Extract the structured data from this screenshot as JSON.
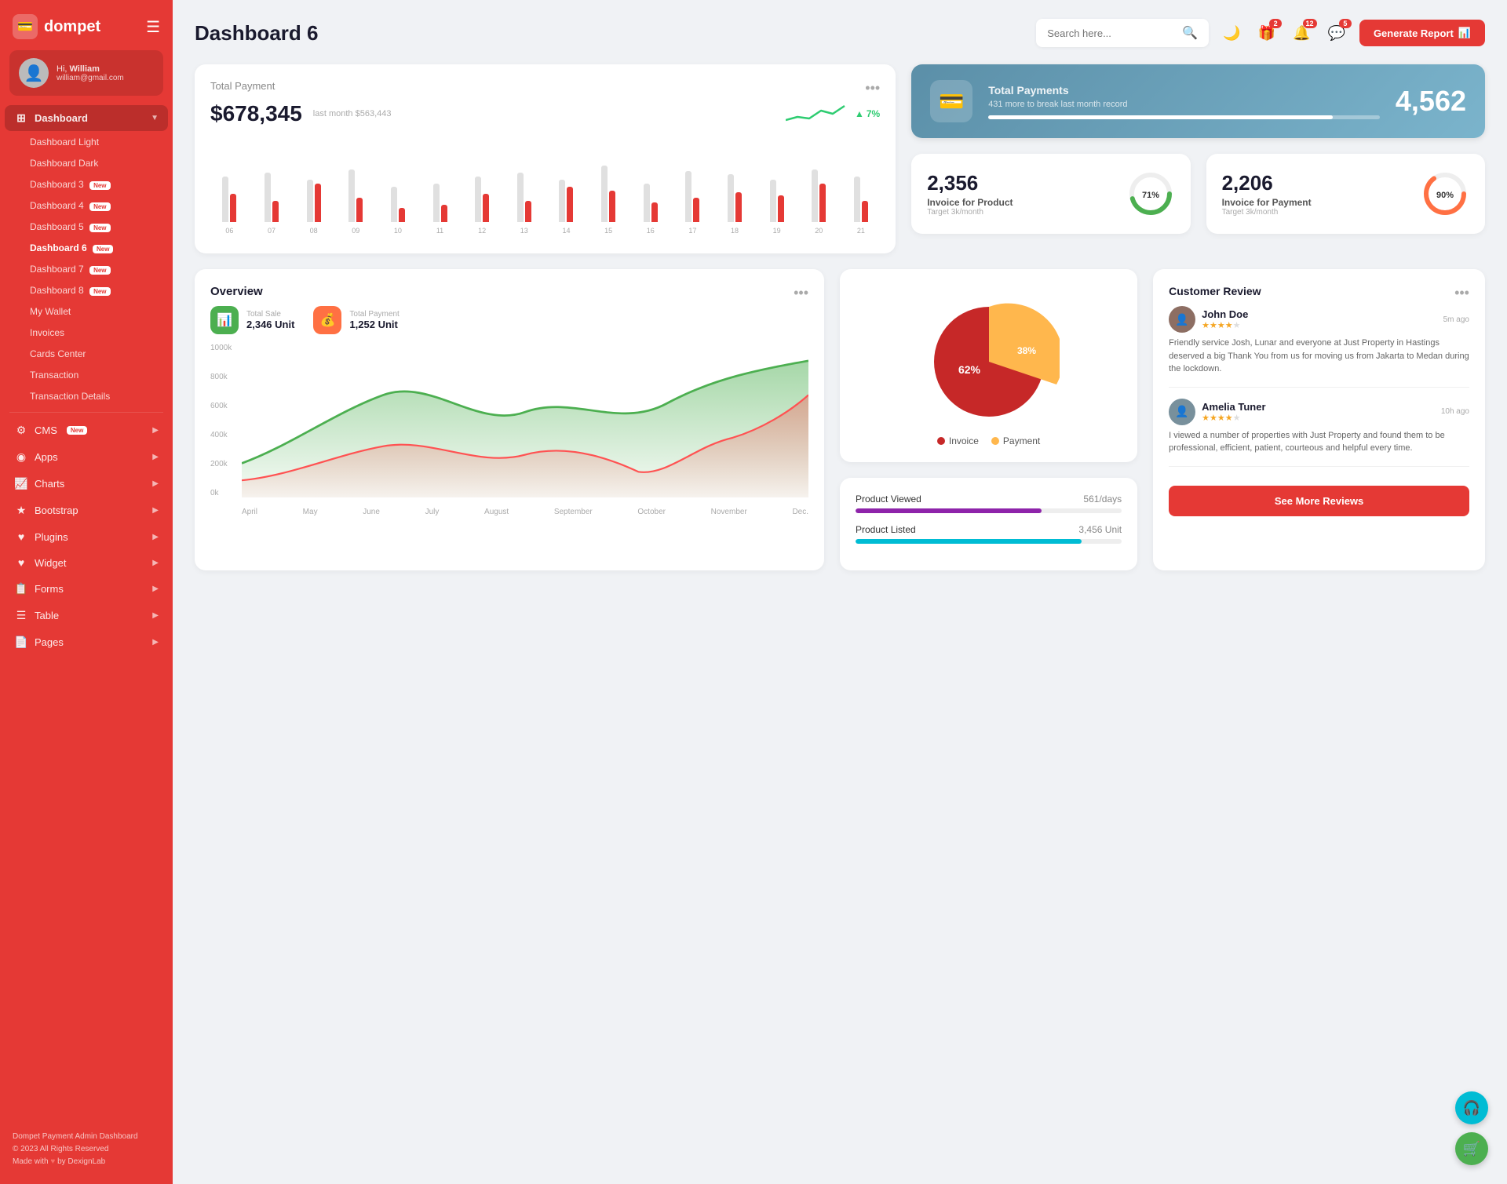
{
  "app": {
    "name": "dompet",
    "logo_icon": "💳"
  },
  "user": {
    "greeting": "Hi, William",
    "name": "William",
    "email": "william@gmail.com",
    "avatar_icon": "👤"
  },
  "sidebar": {
    "nav": [
      {
        "id": "dashboard",
        "label": "Dashboard",
        "icon": "⊞",
        "has_arrow": true,
        "active": true
      },
      {
        "id": "cms",
        "label": "CMS",
        "icon": "⚙",
        "has_arrow": true,
        "badge": "New"
      },
      {
        "id": "apps",
        "label": "Apps",
        "icon": "◉",
        "has_arrow": true
      },
      {
        "id": "charts",
        "label": "Charts",
        "icon": "📈",
        "has_arrow": true
      },
      {
        "id": "bootstrap",
        "label": "Bootstrap",
        "icon": "★",
        "has_arrow": true
      },
      {
        "id": "plugins",
        "label": "Plugins",
        "icon": "♥",
        "has_arrow": true
      },
      {
        "id": "widget",
        "label": "Widget",
        "icon": "♥",
        "has_arrow": true
      },
      {
        "id": "forms",
        "label": "Forms",
        "icon": "🖨",
        "has_arrow": true
      },
      {
        "id": "table",
        "label": "Table",
        "icon": "☰",
        "has_arrow": true
      },
      {
        "id": "pages",
        "label": "Pages",
        "icon": "📄",
        "has_arrow": true
      }
    ],
    "sub_nav": [
      {
        "id": "dashboard-light",
        "label": "Dashboard Light",
        "active": false
      },
      {
        "id": "dashboard-dark",
        "label": "Dashboard Dark",
        "active": false
      },
      {
        "id": "dashboard-3",
        "label": "Dashboard 3",
        "badge": "New",
        "active": false
      },
      {
        "id": "dashboard-4",
        "label": "Dashboard 4",
        "badge": "New",
        "active": false
      },
      {
        "id": "dashboard-5",
        "label": "Dashboard 5",
        "badge": "New",
        "active": false
      },
      {
        "id": "dashboard-6",
        "label": "Dashboard 6",
        "badge": "New",
        "active": true
      },
      {
        "id": "dashboard-7",
        "label": "Dashboard 7",
        "badge": "New",
        "active": false
      },
      {
        "id": "dashboard-8",
        "label": "Dashboard 8",
        "badge": "New",
        "active": false
      },
      {
        "id": "my-wallet",
        "label": "My Wallet",
        "active": false
      },
      {
        "id": "invoices",
        "label": "Invoices",
        "active": false
      },
      {
        "id": "cards-center",
        "label": "Cards Center",
        "active": false
      },
      {
        "id": "transaction",
        "label": "Transaction",
        "active": false
      },
      {
        "id": "transaction-details",
        "label": "Transaction Details",
        "active": false
      }
    ],
    "footer": {
      "brand": "Dompet Payment Admin Dashboard",
      "copy": "© 2023 All Rights Reserved",
      "made": "Made with",
      "by": "by DexignLab"
    }
  },
  "header": {
    "title": "Dashboard 6",
    "search_placeholder": "Search here...",
    "notifications": [
      {
        "id": "gift",
        "icon": "🎁",
        "count": 2
      },
      {
        "id": "bell",
        "icon": "🔔",
        "count": 12
      },
      {
        "id": "chat",
        "icon": "💬",
        "count": 5
      }
    ],
    "generate_btn": "Generate Report"
  },
  "total_payment": {
    "title": "Total Payment",
    "amount": "$678,345",
    "last_month_label": "last month $563,443",
    "trend": "7%",
    "trend_up": true,
    "bars": [
      {
        "label": "06",
        "light": 65,
        "red": 40
      },
      {
        "label": "07",
        "light": 70,
        "red": 30
      },
      {
        "label": "08",
        "light": 60,
        "red": 55
      },
      {
        "label": "09",
        "light": 75,
        "red": 35
      },
      {
        "label": "10",
        "light": 50,
        "red": 20
      },
      {
        "label": "11",
        "light": 55,
        "red": 25
      },
      {
        "label": "12",
        "light": 65,
        "red": 40
      },
      {
        "label": "13",
        "light": 70,
        "red": 30
      },
      {
        "label": "14",
        "light": 60,
        "red": 50
      },
      {
        "label": "15",
        "light": 80,
        "red": 45
      },
      {
        "label": "16",
        "light": 55,
        "red": 28
      },
      {
        "label": "17",
        "light": 72,
        "red": 35
      },
      {
        "label": "18",
        "light": 68,
        "red": 42
      },
      {
        "label": "19",
        "light": 60,
        "red": 38
      },
      {
        "label": "20",
        "light": 75,
        "red": 55
      },
      {
        "label": "21",
        "light": 65,
        "red": 30
      }
    ]
  },
  "total_payments_card": {
    "title": "Total Payments",
    "subtitle": "431 more to break last month record",
    "number": "4,562",
    "bar_percent": 88,
    "icon": "💳"
  },
  "invoice_product": {
    "number": "2,356",
    "label": "Invoice for Product",
    "sub": "Target 3k/month",
    "percent": 71,
    "color": "#4caf50"
  },
  "invoice_payment": {
    "number": "2,206",
    "label": "Invoice for Payment",
    "sub": "Target 3k/month",
    "percent": 90,
    "color": "#ff7043"
  },
  "overview": {
    "title": "Overview",
    "total_sale": {
      "label": "Total Sale",
      "value": "2,346 Unit"
    },
    "total_payment": {
      "label": "Total Payment",
      "value": "1,252 Unit"
    },
    "y_labels": [
      "1000k",
      "800k",
      "600k",
      "400k",
      "200k",
      "0k"
    ],
    "x_labels": [
      "April",
      "May",
      "June",
      "July",
      "August",
      "September",
      "October",
      "November",
      "Dec."
    ]
  },
  "pie_chart": {
    "invoice_percent": 62,
    "payment_percent": 38,
    "invoice_color": "#c62828",
    "payment_color": "#ffb74d",
    "legend": [
      {
        "label": "Invoice",
        "color": "#c62828"
      },
      {
        "label": "Payment",
        "color": "#ffb74d"
      }
    ]
  },
  "product_stats": [
    {
      "id": "viewed",
      "label": "Product Viewed",
      "value": "561/days",
      "color": "purple",
      "percent": 70
    },
    {
      "id": "listed",
      "label": "Product Listed",
      "value": "3,456 Unit",
      "color": "teal",
      "percent": 85
    }
  ],
  "customer_review": {
    "title": "Customer Review",
    "see_more": "See More Reviews",
    "reviews": [
      {
        "name": "John Doe",
        "time": "5m ago",
        "rating": 4,
        "max_rating": 5,
        "text": "Friendly service Josh, Lunar and everyone at Just Property in Hastings deserved a big Thank You from us for moving us from Jakarta to Medan during the lockdown.",
        "avatar_color": "#8d6e63"
      },
      {
        "name": "Amelia Tuner",
        "time": "10h ago",
        "rating": 4,
        "max_rating": 5,
        "text": "I viewed a number of properties with Just Property and found them to be professional, efficient, patient, courteous and helpful every time.",
        "avatar_color": "#78909c"
      }
    ]
  },
  "float_buttons": [
    {
      "id": "headset",
      "icon": "🎧",
      "color": "#00bcd4"
    },
    {
      "id": "cart",
      "icon": "🛒",
      "color": "#4caf50"
    }
  ]
}
